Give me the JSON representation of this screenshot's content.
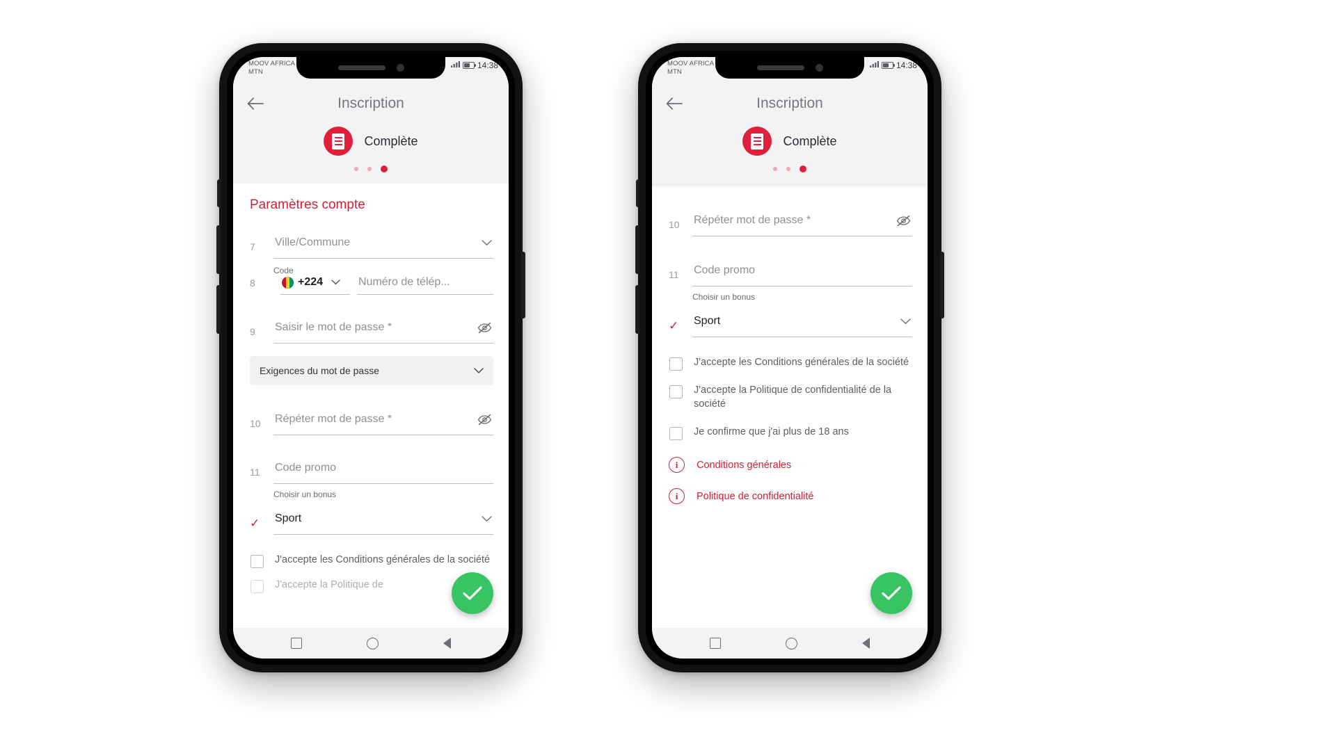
{
  "status_bar": {
    "carrier_line1": "MOOV AFRICA",
    "carrier_line2": "MTN",
    "time": "14:38",
    "signal_icon": "signal-bars-icon",
    "battery_icon": "battery-icon"
  },
  "header": {
    "back_icon": "back-arrow-icon",
    "title": "Inscription",
    "step_icon": "document-icon",
    "step_label": "Complète",
    "dots_total": 3,
    "dots_active_index": 2
  },
  "colors": {
    "brand_red": "#cf1f36",
    "badge_red": "#e0203a",
    "fab_green": "#38c463",
    "placeholder_grey": "#8f8f95"
  },
  "left_phone": {
    "section_title": "Paramètres compte",
    "fields": {
      "city": {
        "index": "7",
        "placeholder": "Ville/Commune",
        "icon": "chevron-down-icon"
      },
      "code_label": "Code",
      "country_code": {
        "index": "8",
        "value": "+224",
        "flag": "guinea-flag-icon",
        "icon": "chevron-down-icon"
      },
      "phone": {
        "placeholder": "Numéro de télép..."
      },
      "password": {
        "index": "9",
        "placeholder": "Saisir le mot de passe *",
        "icon": "eye-off-icon"
      },
      "requirements": {
        "label": "Exigences du mot de passe",
        "icon": "chevron-down-icon"
      },
      "repeat_password": {
        "index": "10",
        "placeholder": "Répéter mot de passe *",
        "icon": "eye-off-icon"
      },
      "promo": {
        "index": "11",
        "placeholder": "Code promo"
      },
      "bonus_label": "Choisir un bonus",
      "bonus": {
        "value": "Sport",
        "tick": "✓",
        "icon": "chevron-down-icon"
      }
    },
    "checkbox": {
      "terms": "J'accepte les Conditions générales de la société",
      "partial_next": "J'accepte la Politique de"
    },
    "fab_icon": "checkmark-icon"
  },
  "right_phone": {
    "fields": {
      "repeat_password": {
        "index": "10",
        "placeholder": "Répéter mot de passe *",
        "icon": "eye-off-icon"
      },
      "promo": {
        "index": "11",
        "placeholder": "Code promo"
      },
      "bonus_label": "Choisir un bonus",
      "bonus": {
        "value": "Sport",
        "tick": "✓",
        "icon": "chevron-down-icon"
      }
    },
    "checkboxes": [
      {
        "label": "J'accepte les Conditions générales de la société",
        "checked": false
      },
      {
        "label": "J'accepte la Politique de confidentialité de la société",
        "checked": false
      },
      {
        "label": "Je confirme que j'ai plus de 18 ans",
        "checked": false
      }
    ],
    "links": [
      {
        "label": "Conditions générales",
        "icon": "info-circle-icon",
        "marker": "i"
      },
      {
        "label": "Politique de confidentialité",
        "icon": "info-circle-icon",
        "marker": "i"
      }
    ],
    "fab_icon": "checkmark-icon"
  },
  "nav_bar": {
    "recents_icon": "square-icon",
    "home_icon": "circle-icon",
    "back_icon": "triangle-back-icon"
  }
}
